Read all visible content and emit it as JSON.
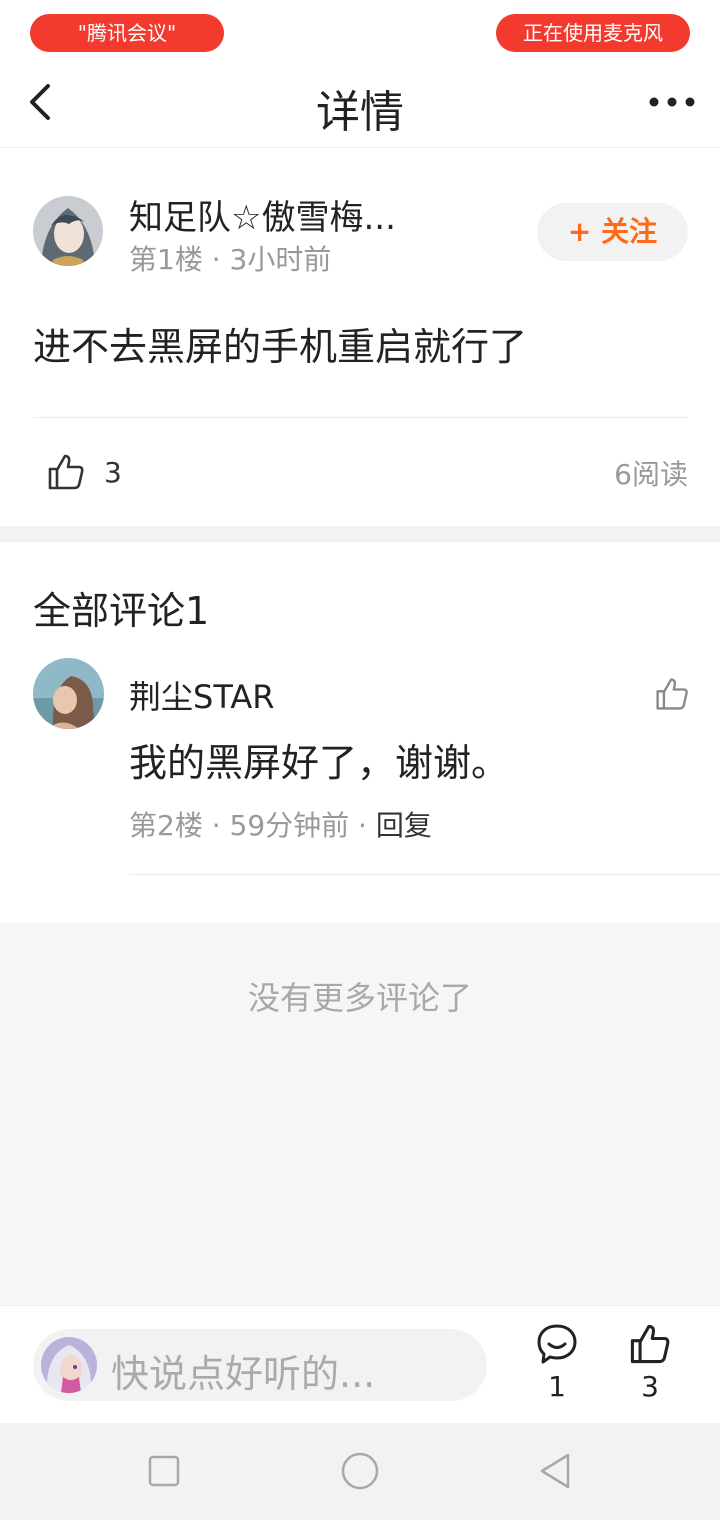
{
  "status": {
    "left_pill": "\"腾讯会议\"",
    "right_pill": "正在使用麦克风",
    "pill_color": "#f23a2e"
  },
  "header": {
    "title": "详情",
    "back_icon": "chevron-left-icon",
    "more_icon": "more-dots-icon"
  },
  "post": {
    "author": "知足队☆傲雪梅...",
    "meta": "第1楼 · 3小时前",
    "follow_label": "+ 关注",
    "content": "进不去黑屏的手机重启就行了",
    "like_count": "3",
    "read_count": "6阅读"
  },
  "comments": {
    "title": "全部评论1",
    "items": [
      {
        "author": "荆尘STAR",
        "text": "我的黑屏好了，谢谢。",
        "meta": "第2楼 · 59分钟前 · ",
        "reply_label": "回复"
      }
    ],
    "no_more": "没有更多评论了"
  },
  "bottom_bar": {
    "input_placeholder": "快说点好听的...",
    "comment_count": "1",
    "like_count": "3"
  },
  "colors": {
    "accent": "#ff6a1a",
    "muted_text": "#999999"
  }
}
